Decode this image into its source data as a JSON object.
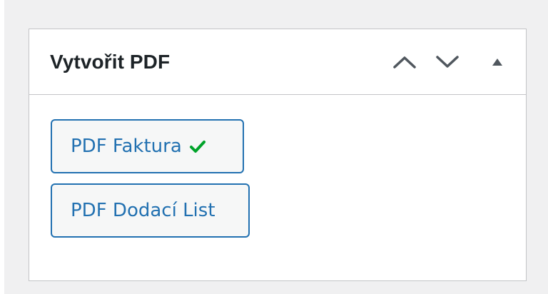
{
  "postbox": {
    "title": "Vytvořit PDF",
    "controls": {
      "move_up": "chevron-up-icon",
      "move_down": "chevron-down-icon",
      "toggle": "triangle-up-icon"
    }
  },
  "buttons": [
    {
      "label": "PDF Faktura",
      "status_icon": "checkmark-icon",
      "status_color": "#00a32a"
    },
    {
      "label": "PDF Dodací List"
    }
  ],
  "colors": {
    "accent": "#2271b1",
    "background": "#f0f0f1",
    "border": "#c3c4c7",
    "title": "#1d2327",
    "icon": "#50575e"
  }
}
